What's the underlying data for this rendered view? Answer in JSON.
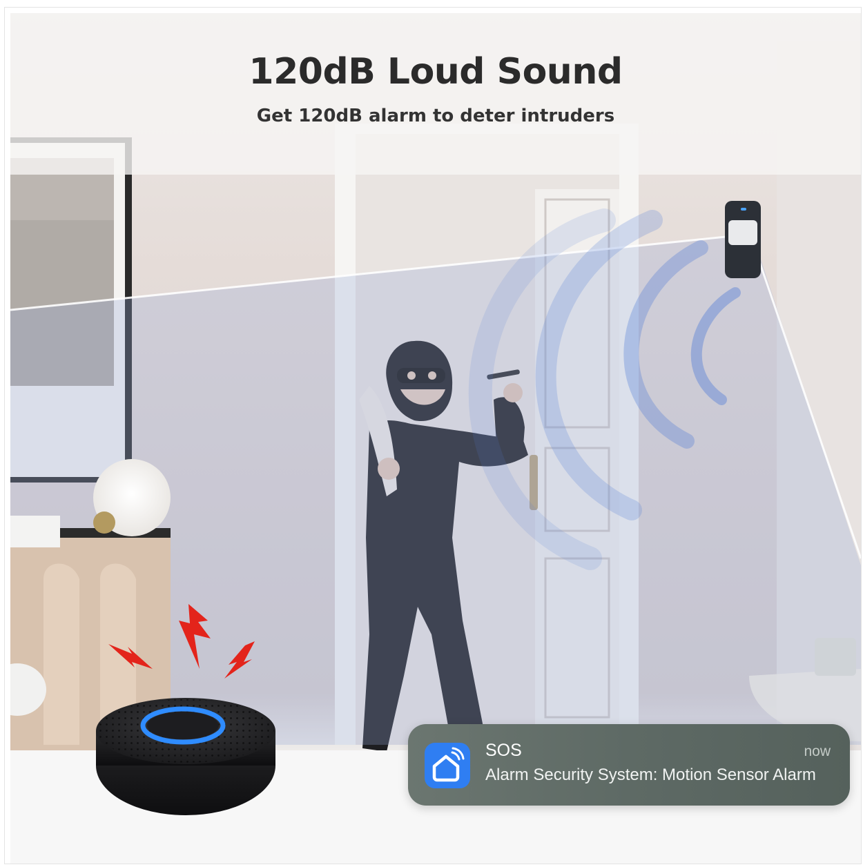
{
  "banner": {
    "title": "120dB Loud Sound",
    "subtitle": "Get 120dB alarm to deter intruders"
  },
  "notification": {
    "app_icon": "smart-home-wifi-icon",
    "title": "SOS",
    "time": "now",
    "message": "Alarm Security System: Motion Sensor Alarm"
  },
  "colors": {
    "alert_red": "#e3241b",
    "siren_ring_blue": "#2f8cff",
    "app_icon_blue": "#2f7ef2",
    "notification_bg": "#5e6a65"
  }
}
